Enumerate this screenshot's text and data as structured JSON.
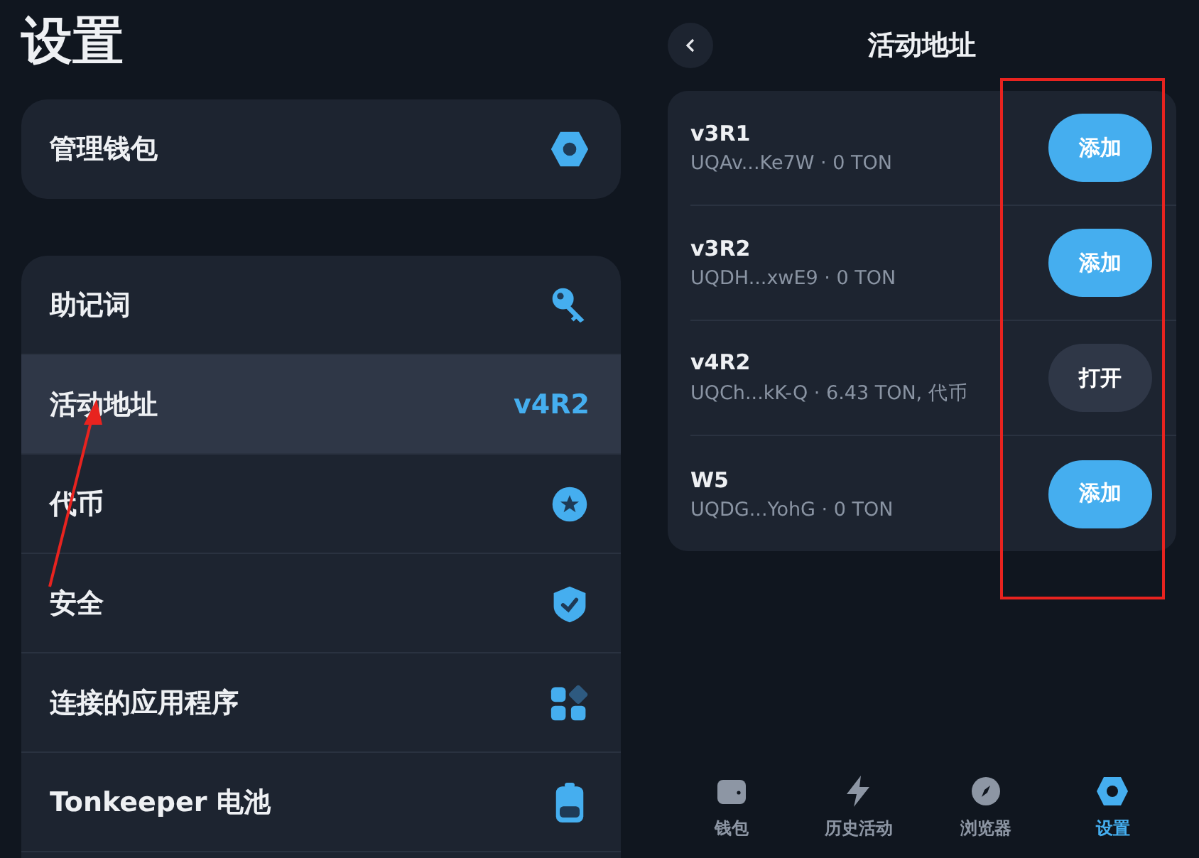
{
  "settings": {
    "title": "设置",
    "wallet_card": {
      "label": "管理钱包"
    },
    "items": [
      {
        "label": "助记词",
        "selected": false
      },
      {
        "label": "活动地址",
        "value": "v4R2",
        "selected": true
      },
      {
        "label": "代币",
        "selected": false
      },
      {
        "label": "安全",
        "selected": false
      },
      {
        "label": "连接的应用程序",
        "selected": false
      },
      {
        "label": "Tonkeeper 电池",
        "selected": false
      }
    ]
  },
  "active_address": {
    "title": "活动地址",
    "wallets": [
      {
        "version": "v3R1",
        "details": "UQAv...Ke7W · 0 TON",
        "button": {
          "label": "添加",
          "kind": "add"
        }
      },
      {
        "version": "v3R2",
        "details": "UQDH...xwE9 · 0 TON",
        "button": {
          "label": "添加",
          "kind": "add"
        }
      },
      {
        "version": "v4R2",
        "details": "UQCh...kK-Q · 6.43 TON, 代币",
        "button": {
          "label": "打开",
          "kind": "open"
        }
      },
      {
        "version": "W5",
        "details": "UQDG...YohG · 0 TON",
        "button": {
          "label": "添加",
          "kind": "add"
        }
      }
    ]
  },
  "tab_bar": [
    {
      "label": "钱包",
      "selected": false
    },
    {
      "label": "历史活动",
      "selected": false
    },
    {
      "label": "浏览器",
      "selected": false
    },
    {
      "label": "设置",
      "selected": true
    }
  ]
}
